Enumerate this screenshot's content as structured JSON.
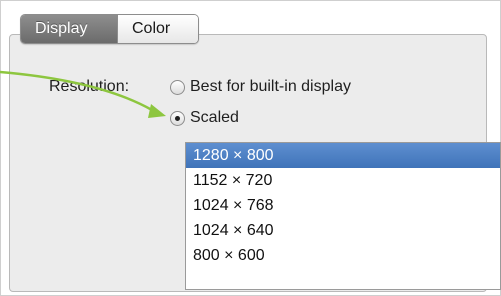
{
  "tabs": [
    {
      "label": "Display",
      "selected": true
    },
    {
      "label": "Color",
      "selected": false
    }
  ],
  "resolution": {
    "label": "Resolution:",
    "options": [
      {
        "label": "Best for built-in display",
        "selected": false
      },
      {
        "label": "Scaled",
        "selected": true
      }
    ],
    "list": [
      {
        "label": "1280 × 800",
        "selected": true
      },
      {
        "label": "1152 × 720",
        "selected": false
      },
      {
        "label": "1024 × 768",
        "selected": false
      },
      {
        "label": "1024 × 640",
        "selected": false
      },
      {
        "label": "800 × 600",
        "selected": false
      }
    ]
  },
  "annotation": {
    "arrow_color": "#8dc63f",
    "selected_item_color": "#4a80c7"
  }
}
